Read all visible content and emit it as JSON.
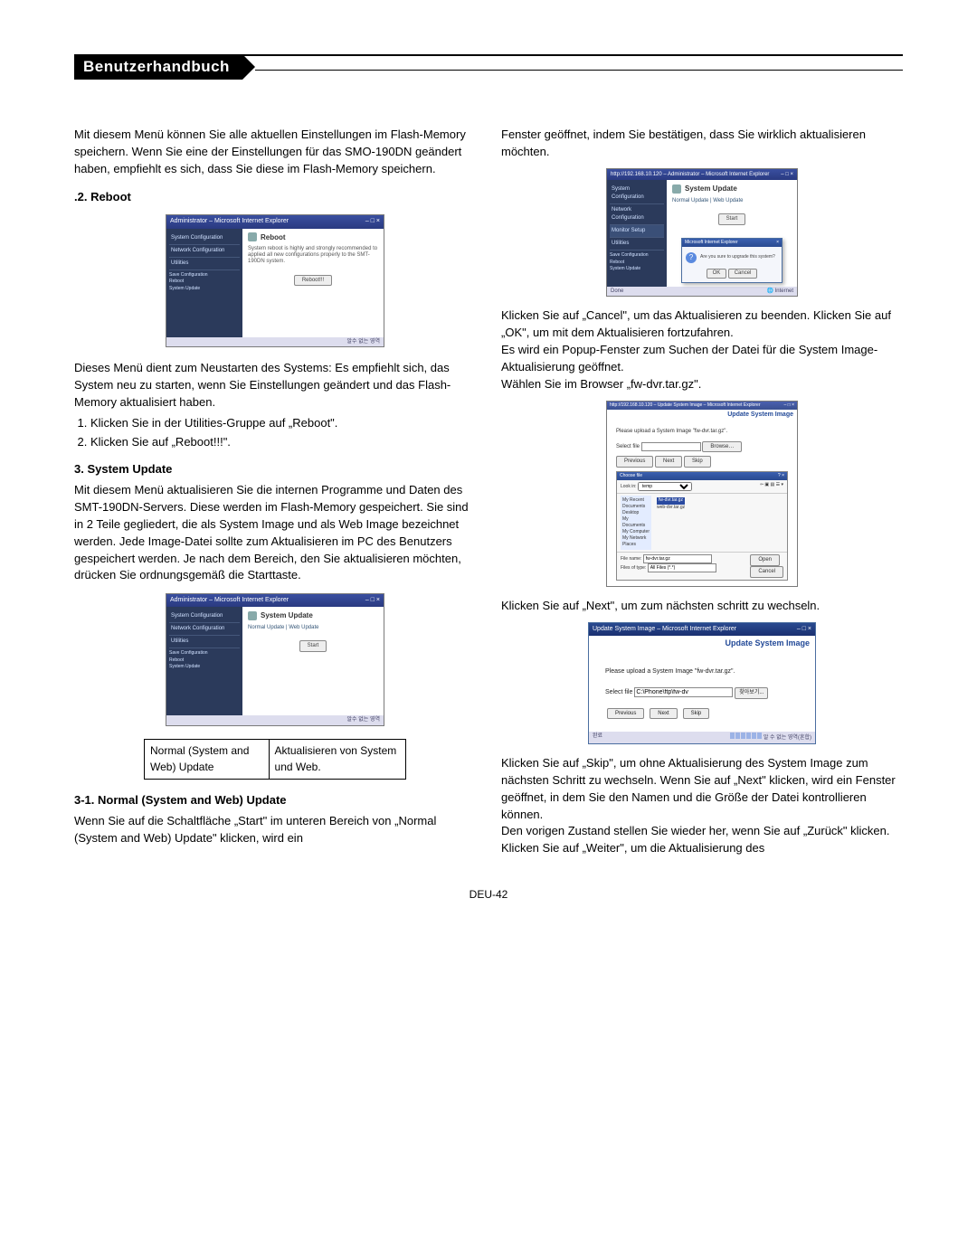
{
  "header": {
    "title": "Benutzerhandbuch"
  },
  "footer": {
    "page": "DEU-42"
  },
  "col1": {
    "intro": "Mit diesem Menü können Sie alle aktuellen Einstellungen im Flash-Memory speichern. Wenn Sie eine der Einstellungen für das SMO-190DN geändert haben, empfiehlt es sich, dass Sie diese im Flash-Memory speichern.",
    "reboot_heading": ".2. Reboot",
    "reboot_shot": {
      "title": "Administrator – Microsoft Internet Explorer",
      "sidebar": [
        "System Configuration",
        "Network Configuration",
        "Utilities"
      ],
      "sidebar_sub": [
        "Save Configuration",
        "Reboot",
        "System Update"
      ],
      "main_head": "Reboot",
      "desc": "System reboot is highly and strongly recommended to applied all new configurations properly to the SMT-190DN system.",
      "btn": "Reboot!!!",
      "status": "알수 없는 영역"
    },
    "reboot_text": "Dieses Menü dient zum Neustarten des Systems: Es empfiehlt sich, das System neu zu starten, wenn Sie Einstellungen geändert und das Flash-Memory aktualisiert haben.",
    "reboot_steps": [
      "Klicken Sie in der Utilities-Gruppe auf „Reboot\".",
      "Klicken Sie auf „Reboot!!!\"."
    ],
    "sysupd_heading": "3. System Update",
    "sysupd_text": "Mit diesem Menü aktualisieren Sie die internen Programme und Daten des SMT-190DN-Servers. Diese werden im Flash-Memory gespeichert. Sie sind in 2 Teile gegliedert, die als System Image und als Web Image bezeichnet werden. Jede Image-Datei sollte zum Aktualisieren im PC des Benutzers gespeichert werden. Je nach dem Bereich, den Sie aktualisieren möchten, drücken Sie ordnungsgemäß die Starttaste.",
    "sysupd_shot": {
      "title": "Administrator – Microsoft Internet Explorer",
      "main_head": "System Update",
      "links": "Normal Update | Web Update",
      "btn": "Start",
      "status": "알수 없는 영역"
    },
    "update_table": {
      "r1c1": "Normal (System and Web) Update",
      "r1c2": "Aktualisieren von System und Web."
    },
    "normal_heading": "3-1. Normal (System and Web) Update",
    "normal_text": "Wenn Sie auf die Schaltfläche „Start\" im unteren Bereich von „Normal (System and Web) Update\" klicken, wird ein"
  },
  "col2": {
    "confirm_intro": "Fenster geöffnet, indem Sie bestätigen, dass Sie wirklich aktualisieren möchten.",
    "confirm_shot": {
      "title": "http://192.168.10.120 – Administrator – Microsoft Internet Explorer",
      "main_head": "System Update",
      "links": "Normal Update | Web Update",
      "btn": "Start",
      "popup_title": "Microsoft Internet Explorer",
      "popup_msg": "Are you sure to upgrade this system?",
      "ok": "OK",
      "cancel": "Cancel",
      "status_icon": "Internet"
    },
    "confirm_text": "Klicken Sie auf „Cancel\", um das Aktualisieren zu beenden. Klicken Sie auf „OK\", um mit dem Aktualisieren fortzufahren.\nEs wird ein Popup-Fenster zum Suchen der Datei für die System Image-Aktualisierung geöffnet.\nWählen Sie im Browser „fw-dvr.tar.gz\".",
    "upload_shot": {
      "title_right": "Update System Image",
      "titlebar": "http://192.168.10.120 – Update System Image – Microsoft Internet Explorer",
      "instruction": "Please upload a System Image \"fw-dvr.tar.gz\".",
      "select_label": "Select file",
      "browse": "Browse…",
      "prev": "Previous",
      "next": "Next",
      "skip": "Skip",
      "fd_title": "Choose file",
      "fd_lookin": "Look in:",
      "fd_items": [
        "fw-dvr.tar.gz",
        "web-dvr.tar.gz"
      ],
      "fd_left": [
        "My Recent Documents",
        "Desktop",
        "My Documents",
        "My Computer",
        "My Network Places"
      ],
      "fd_filename": "File name:",
      "fd_filetype": "Files of type:",
      "fd_open": "Open",
      "fd_cancel": "Cancel",
      "fd_filename_val": "fw-dvr.tar.gz",
      "fd_filetype_val": "All Files (*.*)"
    },
    "next_text": "Klicken Sie auf „Next\", um zum nächsten schritt zu wechseln.",
    "next_shot": {
      "title": "Update System Image – Microsoft Internet Explorer",
      "header": "Update System Image",
      "msg": "Please upload a System Image \"fw-dvr.tar.gz\".",
      "select_label": "Select file",
      "input_val": "C:\\Phone\\ftp\\fw-dv",
      "browse": "찾아보기...",
      "prev": "Previous",
      "next": "Next",
      "skip": "Skip",
      "status_left": "완료",
      "status_right": "알 수 없는 영역(혼합)"
    },
    "skip_text": "Klicken Sie auf „Skip\", um ohne Aktualisierung des System Image zum nächsten Schritt zu wechseln. Wenn Sie auf „Next\" klicken, wird ein Fenster geöffnet, in dem Sie den Namen und die Größe der Datei kontrollieren können.\nDen vorigen Zustand stellen Sie wieder her, wenn Sie auf „Zurück\" klicken.\nKlicken Sie auf „Weiter\", um die Aktualisierung des"
  }
}
